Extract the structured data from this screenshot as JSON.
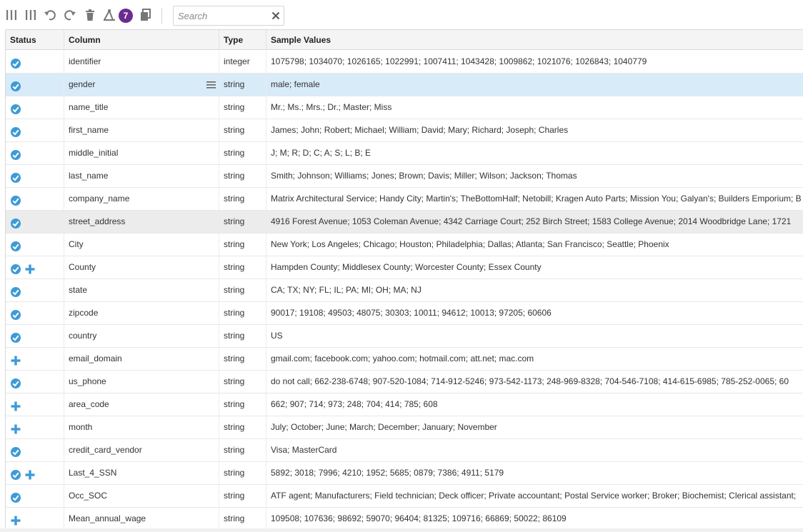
{
  "toolbar": {
    "badge_count": "7",
    "search_placeholder": "Search",
    "search_value": ""
  },
  "table": {
    "headers": {
      "status": "Status",
      "column": "Column",
      "type": "Type",
      "sample": "Sample Values"
    },
    "rows": [
      {
        "status": [
          "check"
        ],
        "column": "identifier",
        "type": "integer",
        "sample": "1075798; 1034070; 1026165; 1022991; 1007411; 1043428; 1009862; 1021076; 1026843; 1040779"
      },
      {
        "status": [
          "check"
        ],
        "column": "gender",
        "type": "string",
        "sample": "male; female",
        "state": "selected"
      },
      {
        "status": [
          "check"
        ],
        "column": "name_title",
        "type": "string",
        "sample": "Mr.; Ms.; Mrs.; Dr.; Master; Miss"
      },
      {
        "status": [
          "check"
        ],
        "column": "first_name",
        "type": "string",
        "sample": "James; John; Robert; Michael; William; David; Mary; Richard; Joseph; Charles"
      },
      {
        "status": [
          "check"
        ],
        "column": "middle_initial",
        "type": "string",
        "sample": "J; M; R; D; C; A; S; L; B; E"
      },
      {
        "status": [
          "check"
        ],
        "column": "last_name",
        "type": "string",
        "sample": "Smith; Johnson; Williams; Jones; Brown; Davis; Miller; Wilson; Jackson; Thomas"
      },
      {
        "status": [
          "check"
        ],
        "column": "company_name",
        "type": "string",
        "sample": "Matrix Architectural Service; Handy City; Martin's; TheBottomHalf; Netobill; Kragen Auto Parts; Mission You; Galyan's; Builders Emporium; B"
      },
      {
        "status": [
          "check"
        ],
        "column": "street_address",
        "type": "string",
        "sample": "4916 Forest Avenue; 1053 Coleman Avenue; 4342 Carriage Court; 252 Birch Street; 1583 College Avenue; 2014 Woodbridge Lane; 1721",
        "state": "hovered"
      },
      {
        "status": [
          "check"
        ],
        "column": "City",
        "type": "string",
        "sample": "New York; Los Angeles; Chicago; Houston; Philadelphia; Dallas; Atlanta; San Francisco; Seattle; Phoenix"
      },
      {
        "status": [
          "check",
          "plus"
        ],
        "column": "County",
        "type": "string",
        "sample": "Hampden County; Middlesex County; Worcester County; Essex County"
      },
      {
        "status": [
          "check"
        ],
        "column": "state",
        "type": "string",
        "sample": "CA; TX; NY; FL; IL; PA; MI; OH; MA; NJ"
      },
      {
        "status": [
          "check"
        ],
        "column": "zipcode",
        "type": "string",
        "sample": "90017; 19108; 49503; 48075; 30303; 10011; 94612; 10013; 97205; 60606"
      },
      {
        "status": [
          "check"
        ],
        "column": "country",
        "type": "string",
        "sample": "US"
      },
      {
        "status": [
          "plus"
        ],
        "column": "email_domain",
        "type": "string",
        "sample": "gmail.com; facebook.com; yahoo.com; hotmail.com; att.net; mac.com"
      },
      {
        "status": [
          "check"
        ],
        "column": "us_phone",
        "type": "string",
        "sample": "do not call; 662-238-6748; 907-520-1084; 714-912-5246; 973-542-1173; 248-969-8328; 704-546-7108; 414-615-6985; 785-252-0065; 60"
      },
      {
        "status": [
          "plus"
        ],
        "column": "area_code",
        "type": "string",
        "sample": "662; 907; 714; 973; 248; 704; 414; 785; 608"
      },
      {
        "status": [
          "plus"
        ],
        "column": "month",
        "type": "string",
        "sample": "July; October; June; March; December; January; November"
      },
      {
        "status": [
          "check"
        ],
        "column": "credit_card_vendor",
        "type": "string",
        "sample": "Visa; MasterCard"
      },
      {
        "status": [
          "check",
          "plus"
        ],
        "column": "Last_4_SSN",
        "type": "string",
        "sample": "5892; 3018; 7996; 4210; 1952; 5685; 0879; 7386; 4911; 5179"
      },
      {
        "status": [
          "check"
        ],
        "column": "Occ_SOC",
        "type": "string",
        "sample": "ATF agent; Manufacturers; Field technician; Deck officer; Private accountant; Postal Service worker; Broker; Biochemist; Clerical assistant;"
      },
      {
        "status": [
          "plus"
        ],
        "column": "Mean_annual_wage",
        "type": "string",
        "sample": "109508; 107636; 98692; 59070; 96404; 81325; 109716; 66869; 50022; 86109"
      }
    ]
  },
  "colors": {
    "accent": "#3d9bd6",
    "badge": "#6b2c91",
    "selected_row": "#d8ebf8",
    "hovered_row": "#ececec",
    "icon_gray": "#777777"
  }
}
